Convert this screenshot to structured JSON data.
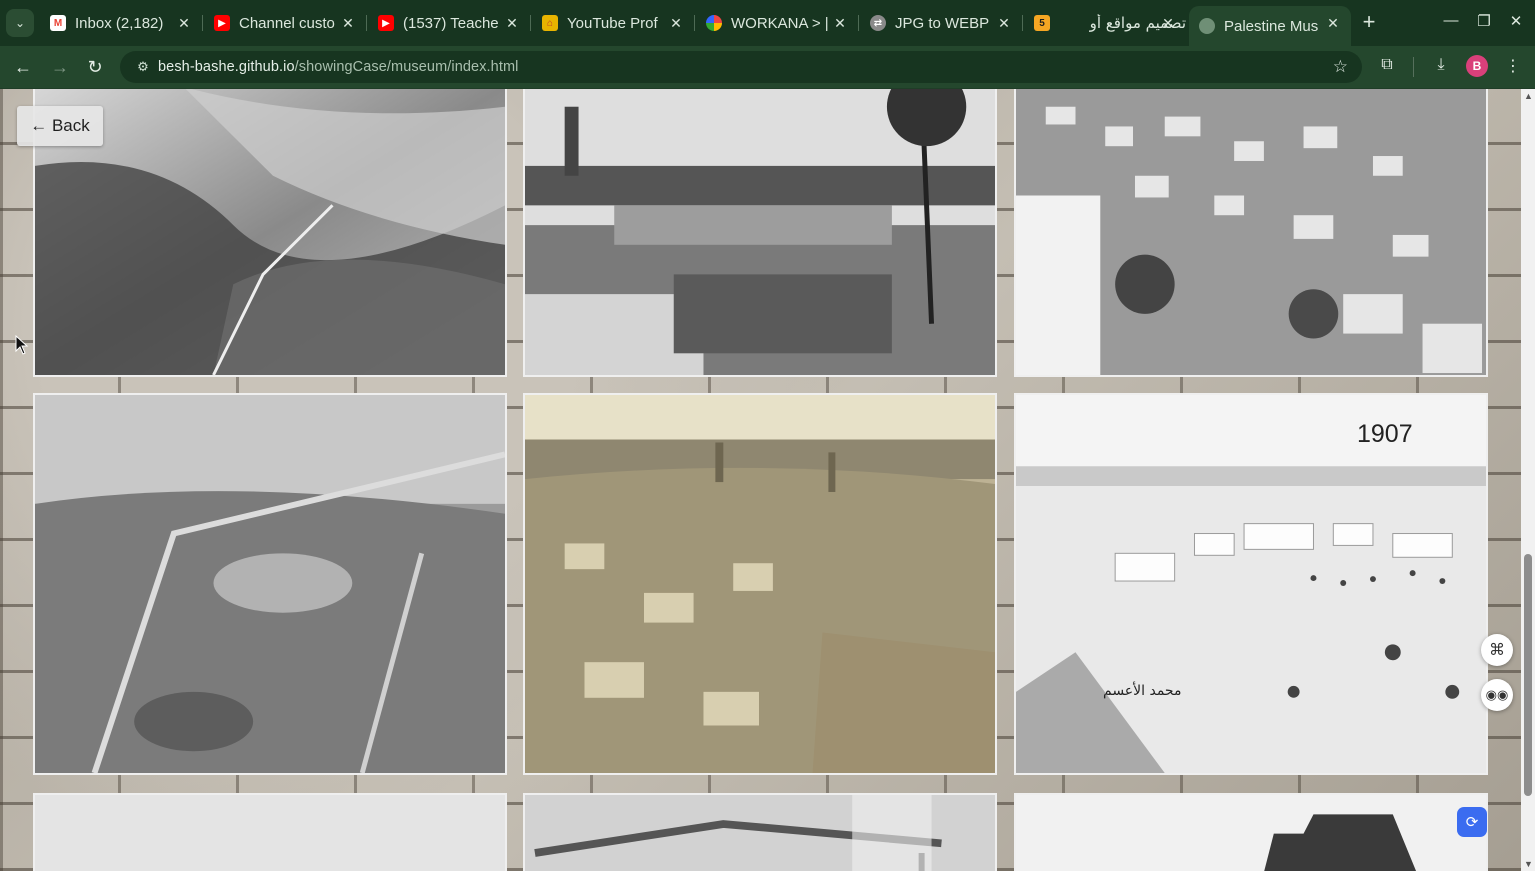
{
  "browser": {
    "tabs": [
      {
        "title": "Inbox (2,182)",
        "icon": "gmail-icon",
        "color": "#ea4335"
      },
      {
        "title": "Channel custo",
        "icon": "youtube-icon",
        "color": "#ff0000"
      },
      {
        "title": "(1537) Teache",
        "icon": "youtube-icon",
        "color": "#ff0000"
      },
      {
        "title": "YouTube Prof",
        "icon": "house-icon",
        "color": "#e8b400"
      },
      {
        "title": "WORKANA > |",
        "icon": "workana-icon",
        "color": "#7b3fe4"
      },
      {
        "title": "JPG to WEBP",
        "icon": "convert-icon",
        "color": "#cccccc"
      },
      {
        "title": "تصميم مواقع أو",
        "icon": "five-icon",
        "color": "#f5a623"
      },
      {
        "title": "Palestine Mus",
        "icon": "globe-icon",
        "color": "#6f8f76"
      }
    ],
    "tab_five_glyph": "5",
    "url_host": "besh-bashe.github.io",
    "url_path": "/showingCase/museum/index.html",
    "profile_initial": "B"
  },
  "page": {
    "back_label": "← Back",
    "photo_year": "1907",
    "photo_caption": "محمد الأعسم"
  },
  "colors": {
    "tabstrip": "#173520",
    "toolbar": "#24472d",
    "accent_avatar": "#d9407a"
  }
}
